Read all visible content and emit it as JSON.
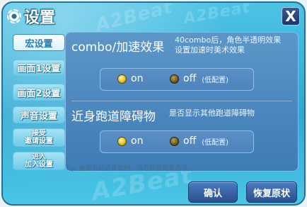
{
  "window": {
    "title": "设置",
    "close_label": "X"
  },
  "watermark": {
    "text": "A2Beat"
  },
  "tabs": [
    {
      "label": "宏设置"
    },
    {
      "label": "画面1设置"
    },
    {
      "label": "画面2设置"
    },
    {
      "label": "声音设置"
    },
    {
      "label": "接受\n邀请设置"
    },
    {
      "label": "进入\n加入设置"
    }
  ],
  "settings": {
    "combo": {
      "title": "combo/加速效果",
      "description_line1": "40combo后，角色半透明效果",
      "description_line2": "设置加速时美术效果",
      "on_label": "on",
      "off_label": "off",
      "off_note": "(低配置)",
      "selected": "off"
    },
    "obstacle": {
      "title": "近身跑道障碍物",
      "description": "是否显示其他跑道障碍物",
      "on_label": "on",
      "off_label": "off",
      "off_note": "(低配置)",
      "selected": "off"
    }
  },
  "tip": "Tip. 画面有延迟现象时，请选择低配置选项。。",
  "buttons": {
    "confirm": "确认",
    "restore": "恢复原状"
  }
}
